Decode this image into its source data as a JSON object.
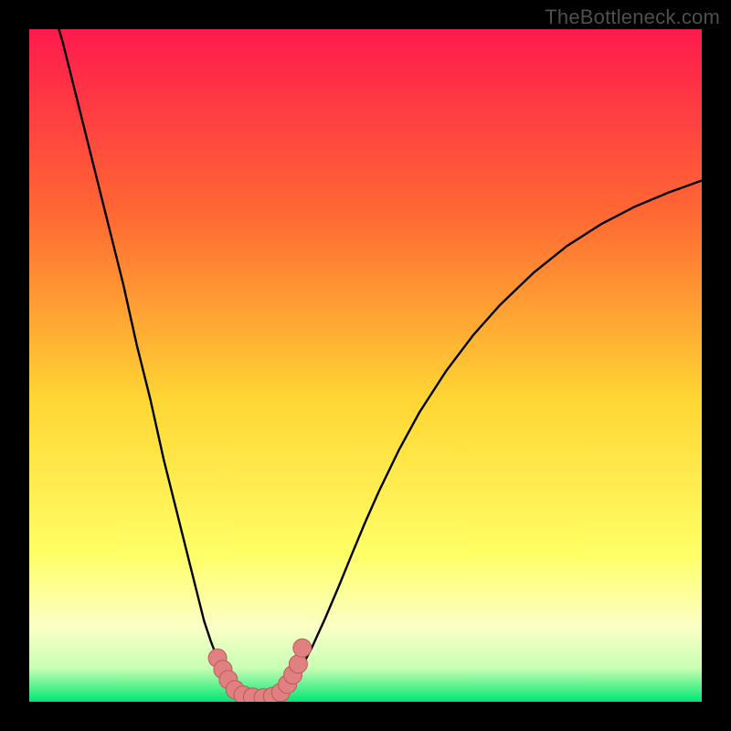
{
  "watermark": "TheBottleneck.com",
  "colors": {
    "bg_black": "#000000",
    "grad_top": "#ff1a4d",
    "grad_mid_top": "#ff8c33",
    "grad_mid": "#ffe733",
    "grad_yellow": "#ffff66",
    "grad_pale": "#fbffc7",
    "grad_green": "#00e673",
    "curve": "#000000",
    "marker_fill": "#e08080",
    "marker_stroke": "#ba5a5a"
  },
  "chart_data": {
    "type": "line",
    "title": "",
    "xlabel": "",
    "ylabel": "",
    "xlim": [
      0,
      100
    ],
    "ylim": [
      0,
      100
    ],
    "x": [
      0,
      5,
      8,
      10,
      12,
      14,
      16,
      18,
      20,
      22,
      24,
      25,
      26,
      27,
      28,
      29,
      30,
      31,
      32,
      33,
      34,
      35,
      36,
      37,
      38,
      39,
      40,
      42,
      44,
      46,
      48,
      50,
      52,
      55,
      58,
      62,
      66,
      70,
      75,
      80,
      85,
      90,
      95,
      100
    ],
    "series": [
      {
        "name": "bottleneck-curve",
        "values": [
          115,
          98,
          86,
          78,
          70,
          62,
          53,
          45,
          36,
          28,
          20,
          16,
          12,
          9,
          6.4,
          4.3,
          2.7,
          1.7,
          1.0,
          0.6,
          0.4,
          0.3,
          0.5,
          0.9,
          1.6,
          2.7,
          4.2,
          8.0,
          12.4,
          17.1,
          22.0,
          26.8,
          31.3,
          37.5,
          43.0,
          49.2,
          54.5,
          59.0,
          63.8,
          67.8,
          71.0,
          73.6,
          75.7,
          77.5
        ]
      }
    ],
    "markers": {
      "name": "highlight-dots",
      "points": [
        {
          "x": 28.0,
          "y": 6.5
        },
        {
          "x": 28.8,
          "y": 4.8
        },
        {
          "x": 29.6,
          "y": 3.3
        },
        {
          "x": 30.6,
          "y": 1.8
        },
        {
          "x": 31.8,
          "y": 1.0
        },
        {
          "x": 33.2,
          "y": 0.7
        },
        {
          "x": 34.8,
          "y": 0.6
        },
        {
          "x": 36.2,
          "y": 0.8
        },
        {
          "x": 37.4,
          "y": 1.4
        },
        {
          "x": 38.4,
          "y": 2.6
        },
        {
          "x": 39.2,
          "y": 4.0
        },
        {
          "x": 40.0,
          "y": 5.6
        },
        {
          "x": 40.6,
          "y": 8.0
        }
      ]
    }
  }
}
